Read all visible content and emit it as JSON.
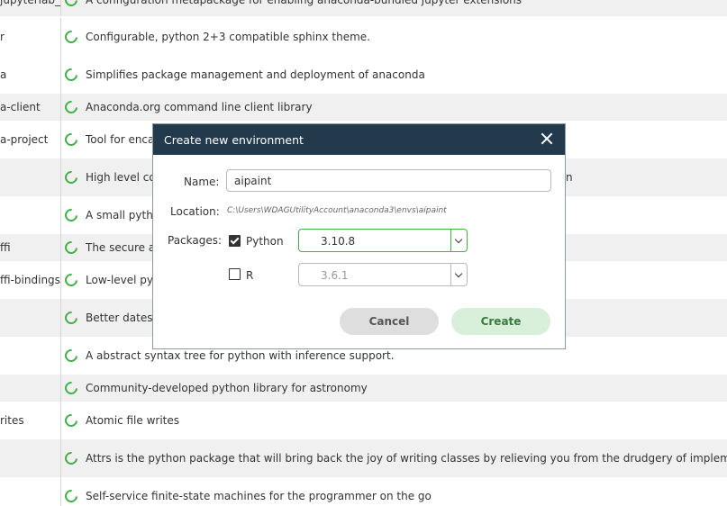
{
  "packages": [
    {
      "name": "jupyterlab_nb_ext…",
      "description": "A configuration metapackage for enabling anaconda-bundled jupyter extensions"
    },
    {
      "name": "r",
      "description": "Configurable, python 2+3 compatible sphinx theme."
    },
    {
      "name": "a",
      "description": "Simplifies package management and deployment of anaconda"
    },
    {
      "name": "a-client",
      "description": "Anaconda.org command line client library"
    },
    {
      "name": "a-project",
      "description": "Tool for enca"
    },
    {
      "name": "",
      "description": "High level co"
    },
    {
      "name": "",
      "description": "A small pytho"
    },
    {
      "name": "ffi",
      "description": "The secure a"
    },
    {
      "name": "ffi-bindings",
      "description": "Low-level py"
    },
    {
      "name": "",
      "description": "Better dates"
    },
    {
      "name": "",
      "description": "A abstract syntax tree for python with inference support."
    },
    {
      "name": "",
      "description": "Community-developed python library for astronomy"
    },
    {
      "name": "rites",
      "description": "Atomic file writes"
    },
    {
      "name": "",
      "description": "Attrs is the python package that will bring back the joy of writing classes by relieving you from the drudgery of implementing o"
    },
    {
      "name": "",
      "description": "Self-service finite-state machines for the programmer on the go"
    }
  ],
  "hidden_text_fragment": "n",
  "dialog": {
    "title": "Create new environment",
    "name_label": "Name:",
    "name_value": "aipaint",
    "location_label": "Location:",
    "location_value": "C:\\Users\\WDAGUtilityAccount\\anaconda3\\envs\\aipaint",
    "packages_label": "Packages:",
    "python": {
      "label": "Python",
      "checked": true,
      "version": "3.10.8"
    },
    "r": {
      "label": "R",
      "checked": false,
      "version": "3.6.1"
    },
    "cancel_label": "Cancel",
    "create_label": "Create"
  },
  "colors": {
    "accent": "#43b049",
    "titlebar": "#233a4c"
  }
}
